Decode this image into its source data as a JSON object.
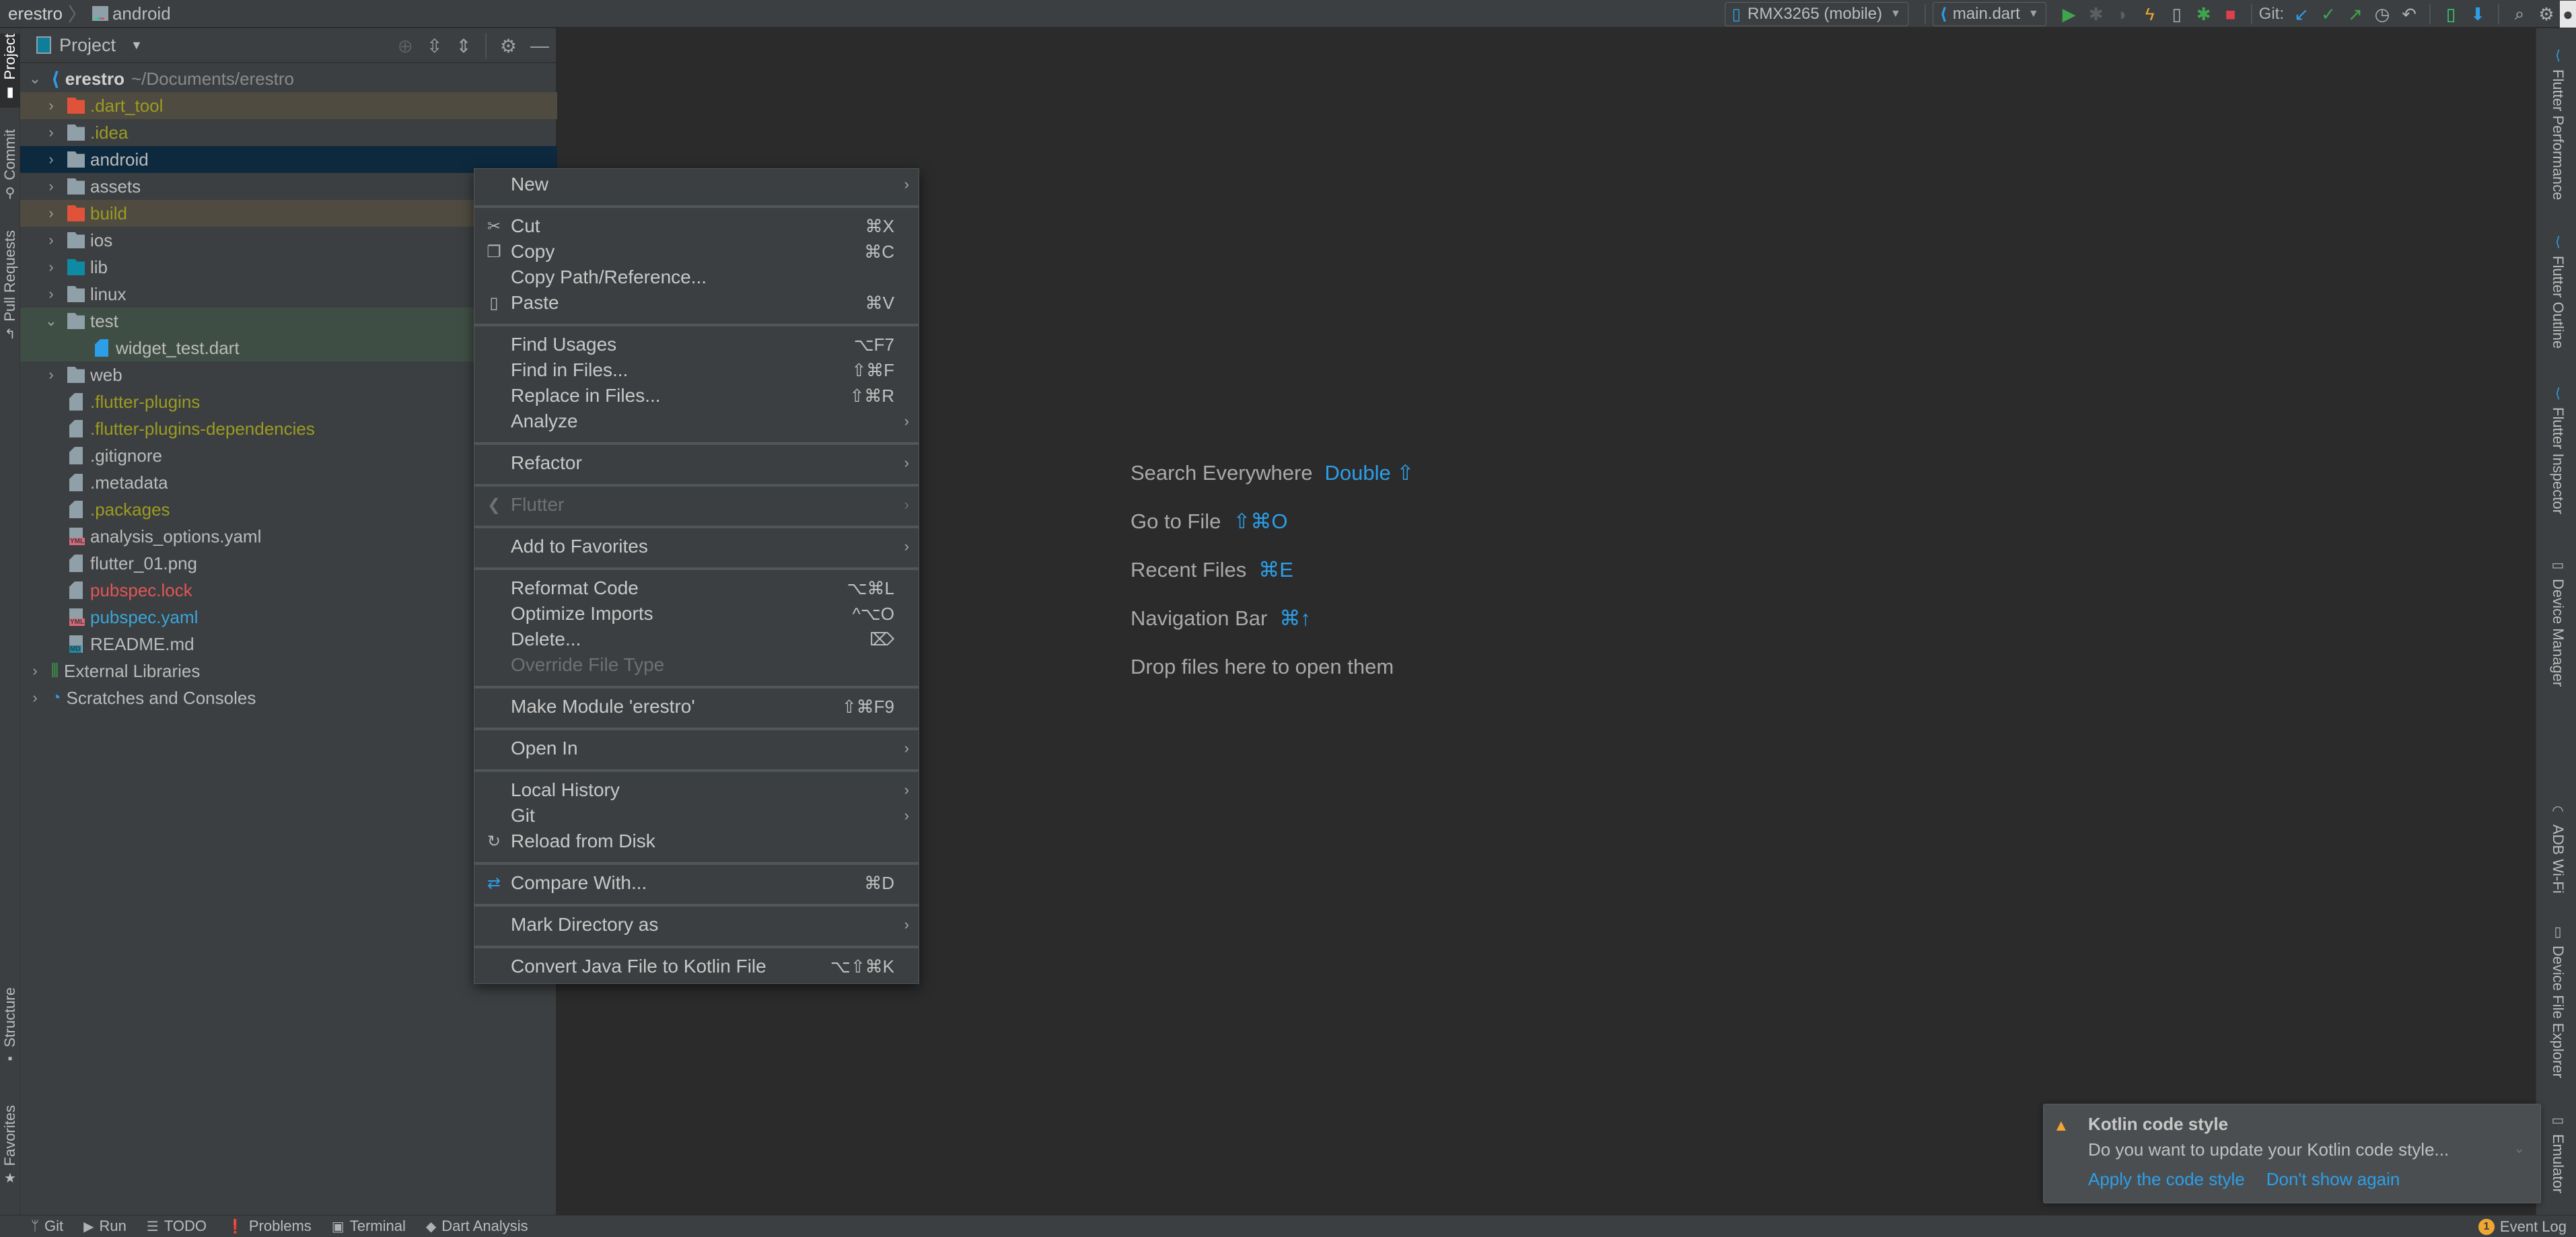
{
  "navbar": {
    "breadcrumb": [
      "erestro",
      "android"
    ],
    "device_selector": "RMX3265 (mobile)",
    "run_config": "main.dart",
    "git_label": "Git:",
    "toolbar_icons": [
      "run-icon",
      "debug-icon",
      "coverage-icon",
      "hot-reload-icon",
      "attach-icon",
      "flutter-debug-icon",
      "stop-icon",
      "git-update-icon",
      "git-commit-icon",
      "git-push-icon",
      "history-icon",
      "rollback-icon",
      "device-manager-icon",
      "sdk-manager-icon",
      "search-icon",
      "settings-icon",
      "profile-icon"
    ]
  },
  "left_stripe": {
    "top": [
      {
        "label": "Project",
        "active": true
      },
      {
        "label": "Commit",
        "active": false
      },
      {
        "label": "Pull Requests",
        "active": false
      }
    ],
    "bottom": [
      {
        "label": "Structure"
      },
      {
        "label": "Favorites"
      }
    ]
  },
  "project_panel": {
    "title": "Project",
    "root": {
      "name": "erestro",
      "path": "~/Documents/erestro"
    },
    "items": [
      {
        "name": ".dart_tool",
        "kind": "folder",
        "color": "ignored",
        "state": "ignored",
        "expandable": true
      },
      {
        "name": ".idea",
        "kind": "folder",
        "color": "ignored",
        "expandable": true
      },
      {
        "name": "android",
        "kind": "folder",
        "color": "default",
        "state": "selected",
        "expandable": true
      },
      {
        "name": "assets",
        "kind": "folder",
        "color": "default",
        "expandable": true
      },
      {
        "name": "build",
        "kind": "folder",
        "color": "ignored",
        "state": "ignored",
        "expandable": true
      },
      {
        "name": "ios",
        "kind": "folder",
        "color": "default",
        "expandable": true
      },
      {
        "name": "lib",
        "kind": "folder",
        "color": "default",
        "expandable": true
      },
      {
        "name": "linux",
        "kind": "folder",
        "color": "default",
        "expandable": true
      },
      {
        "name": "test",
        "kind": "folder",
        "color": "default",
        "state": "test",
        "expanded": true
      },
      {
        "name": "widget_test.dart",
        "kind": "dart-file",
        "color": "default",
        "state": "test",
        "indent": 2
      },
      {
        "name": "web",
        "kind": "folder",
        "color": "default",
        "expandable": true
      },
      {
        "name": ".flutter-plugins",
        "kind": "file",
        "color": "ignored"
      },
      {
        "name": ".flutter-plugins-dependencies",
        "kind": "file",
        "color": "ignored"
      },
      {
        "name": ".gitignore",
        "kind": "file",
        "color": "default"
      },
      {
        "name": ".metadata",
        "kind": "file",
        "color": "default"
      },
      {
        "name": ".packages",
        "kind": "file",
        "color": "ignored"
      },
      {
        "name": "analysis_options.yaml",
        "kind": "yaml",
        "color": "default"
      },
      {
        "name": "flutter_01.png",
        "kind": "image",
        "color": "default"
      },
      {
        "name": "pubspec.lock",
        "kind": "file",
        "color": "red"
      },
      {
        "name": "pubspec.yaml",
        "kind": "yaml",
        "color": "blue"
      },
      {
        "name": "README.md",
        "kind": "md",
        "color": "default"
      }
    ],
    "extra": [
      {
        "name": "External Libraries"
      },
      {
        "name": "Scratches and Consoles"
      }
    ]
  },
  "context_menu": {
    "groups": [
      [
        {
          "label": "New",
          "submenu": true
        }
      ],
      [
        {
          "label": "Cut",
          "shortcut": "⌘X",
          "icon": "cut-icon",
          "glyph": "✂"
        },
        {
          "label": "Copy",
          "shortcut": "⌘C",
          "icon": "copy-icon",
          "glyph": "❐"
        },
        {
          "label": "Copy Path/Reference..."
        },
        {
          "label": "Paste",
          "shortcut": "⌘V",
          "icon": "paste-icon",
          "glyph": "▯"
        }
      ],
      [
        {
          "label": "Find Usages",
          "shortcut": "⌥F7"
        },
        {
          "label": "Find in Files...",
          "shortcut": "⇧⌘F"
        },
        {
          "label": "Replace in Files...",
          "shortcut": "⇧⌘R"
        },
        {
          "label": "Analyze",
          "submenu": true
        }
      ],
      [
        {
          "label": "Refactor",
          "submenu": true
        }
      ],
      [
        {
          "label": "Flutter",
          "submenu": true,
          "disabled": true,
          "icon": "flutter-icon",
          "glyph": "❮"
        }
      ],
      [
        {
          "label": "Add to Favorites",
          "submenu": true
        }
      ],
      [
        {
          "label": "Reformat Code",
          "shortcut": "⌥⌘L"
        },
        {
          "label": "Optimize Imports",
          "shortcut": "^⌥O"
        },
        {
          "label": "Delete...",
          "shortcut": "⌦"
        },
        {
          "label": "Override File Type",
          "disabled": true
        }
      ],
      [
        {
          "label": "Make Module 'erestro'",
          "shortcut": "⇧⌘F9"
        }
      ],
      [
        {
          "label": "Open In",
          "submenu": true
        }
      ],
      [
        {
          "label": "Local History",
          "submenu": true
        },
        {
          "label": "Git",
          "submenu": true
        },
        {
          "label": "Reload from Disk",
          "icon": "reload-icon",
          "glyph": "↻"
        }
      ],
      [
        {
          "label": "Compare With...",
          "shortcut": "⌘D",
          "icon": "compare-icon",
          "glyph": "⇄",
          "icon_color": "blue"
        }
      ],
      [
        {
          "label": "Mark Directory as",
          "submenu": true
        }
      ],
      [
        {
          "label": "Convert Java File to Kotlin File",
          "shortcut": "⌥⇧⌘K"
        }
      ]
    ]
  },
  "editor": {
    "hints": [
      {
        "label": "Search Everywhere",
        "key": "Double ⇧"
      },
      {
        "label": "Go to File",
        "key": "⇧⌘O"
      },
      {
        "label": "Recent Files",
        "key": "⌘E"
      },
      {
        "label": "Navigation Bar",
        "key": "⌘↑"
      },
      {
        "label": "Drop files here to open them",
        "key": ""
      }
    ]
  },
  "right_stripe": [
    {
      "label": "Flutter Performance",
      "icon": "flutter-icon"
    },
    {
      "label": "Flutter Outline",
      "icon": "flutter-icon"
    },
    {
      "label": "Flutter Inspector",
      "icon": "flutter-icon"
    },
    {
      "label": "Device Manager",
      "icon": "device-manager-icon"
    },
    {
      "label": "ADB Wi-Fi",
      "icon": "wifi-icon"
    },
    {
      "label": "Device File Explorer",
      "icon": "device-icon"
    },
    {
      "label": "Emulator",
      "icon": "emulator-icon"
    }
  ],
  "bottom_bar": {
    "tabs": [
      {
        "label": "Git",
        "icon": "git-branch-icon",
        "glyph": "ᛘ"
      },
      {
        "label": "Run",
        "icon": "run-icon",
        "glyph": "▶"
      },
      {
        "label": "TODO",
        "icon": "list-icon",
        "glyph": "☰"
      },
      {
        "label": "Problems",
        "icon": "problems-icon",
        "glyph": "❗"
      },
      {
        "label": "Terminal",
        "icon": "terminal-icon",
        "glyph": "▣"
      },
      {
        "label": "Dart Analysis",
        "icon": "dart-icon",
        "glyph": "◆"
      }
    ],
    "event_log": {
      "label": "Event Log",
      "count": "1"
    }
  },
  "notification": {
    "title": "Kotlin code style",
    "body": "Do you want to update your Kotlin code style...",
    "actions": [
      "Apply the code style",
      "Don't show again"
    ]
  },
  "colors": {
    "accent_blue": "#2c9fe8",
    "selection": "#0d293e",
    "ignored_text": "#9c9b21",
    "modified_red": "#e35555",
    "warning": "#f0a732"
  }
}
